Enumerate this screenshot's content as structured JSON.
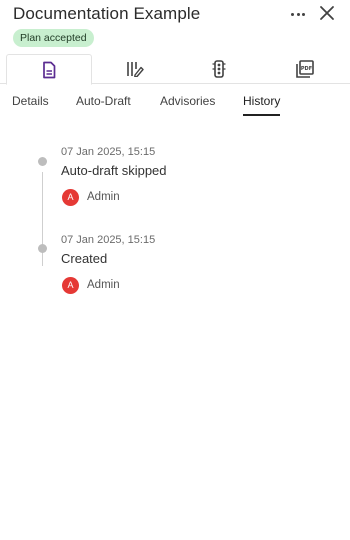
{
  "header": {
    "title": "Documentation Example",
    "status_badge": "Plan accepted"
  },
  "icon_tabs": [
    {
      "icon": "document-icon",
      "active": true
    },
    {
      "icon": "columns-edit-icon",
      "active": false
    },
    {
      "icon": "traffic-light-icon",
      "active": false
    },
    {
      "icon": "pdf-icon",
      "active": false
    }
  ],
  "tabs": [
    {
      "label": "Details",
      "active": false
    },
    {
      "label": "Auto-Draft",
      "active": false
    },
    {
      "label": "Advisories",
      "active": false
    },
    {
      "label": "History",
      "active": true
    }
  ],
  "history": [
    {
      "timestamp": "07 Jan 2025, 15:15",
      "event": "Auto-draft skipped",
      "user": {
        "initial": "A",
        "name": "Admin"
      }
    },
    {
      "timestamp": "07 Jan 2025, 15:15",
      "event": "Created",
      "user": {
        "initial": "A",
        "name": "Admin"
      }
    }
  ],
  "colors": {
    "accent": "#5b2c91",
    "badge_bg": "#c8efcf",
    "avatar_bg": "#e53935"
  }
}
